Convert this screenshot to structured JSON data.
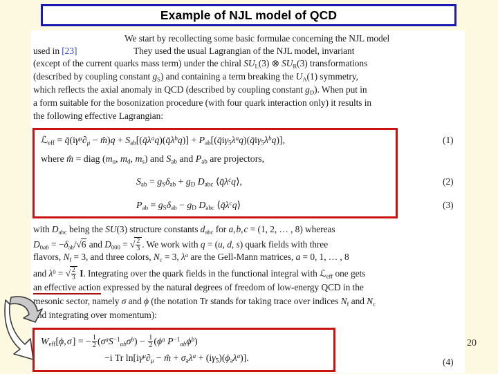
{
  "slide": {
    "title": "Example of NJL model of QCD",
    "page_number": "20",
    "accent_title_border": "#1a1ab4",
    "accent_equation_border": "#cc1111",
    "background": "#fdf9e0",
    "page_background": "#ffffff"
  },
  "body": {
    "paragraph1": [
      "We start by recollecting some basic formulae concerning the NJL model",
      "used in [23]                They used the usual Lagrangian of the NJL model, invariant",
      "(except of the current quarks mass term) under the chiral SU_L(3) ⊗ SU_R(3) transformations",
      "(described by coupling constant g_S) and containing a term breaking the U_A(1) symmetry,",
      "which reflects the axial anomaly in QCD (described by coupling constant g_D). When put in",
      "a form suitable for the bosonization procedure (with four quark interaction only) it results in",
      "the following effective Lagrangian:"
    ],
    "citation": "[23]",
    "paragraph2": [
      "with D_abc being the SU(3) structure constants d_abc for a, b, c = (1, 2, ... , 8) whereas",
      "D_0ab = −δ_ab/√6 and D_000 = √(2/3). We work with q = (u, d, s) quark fields with three",
      "flavors, N_f = 3, and three colors, N_c = 3, λ^a are the Gell-Mann matrices, a = 0, 1, ... , 8",
      "and λ^0 = √(2/3) I. Integrating over the quark fields in the functional integral with L_eff one gets",
      "an effective action expressed by the natural degrees of freedom of low-energy QCD in the",
      "mesonic sector, namely σ and φ (the notation Tr stands for taking trace over indices N_f and N_c",
      "and integrating over momentum):"
    ],
    "underlined_phrase": "an effective action"
  },
  "equations": {
    "eq1_number": "(1)",
    "eq2_number": "(2)",
    "eq3_number": "(3)",
    "eq4_number": "(4)",
    "eq1": "L_eff = q̄(iγ^μ ∂_μ − m̂)q + S_ab[(q̄λ^a q)(q̄λ^b q)] + P_ab[(q̄iγ₅λ^a q)(q̄iγ₅λ^b q)],",
    "eq1_where": "where m̂ = diag (m_u, m_d, m_s) and S_ab and P_ab are projectors,",
    "eq2": "S_ab = g_Sδ_ab + g_D D_abc ⟨q̄λ^c q⟩,",
    "eq3": "P_ab = g_Sδ_ab − g_D D_abc ⟨q̄λ^c q⟩",
    "eq4_line1": "W_eff[φ, σ] = −½(σ^a S^−1_ab σ^b) − ½(φ^a P^−1_ab φ^b)",
    "eq4_line2": "−i Tr ln[iγ^μ ∂_μ − m̂ + σ_aλ^a + (iγ₅)(φ_aλ^a)]."
  },
  "graphics": {
    "arrow_label": "curved-down-right-arrow",
    "arrow_fill": "#c8c8c8",
    "arrow_stroke": "#333333"
  }
}
